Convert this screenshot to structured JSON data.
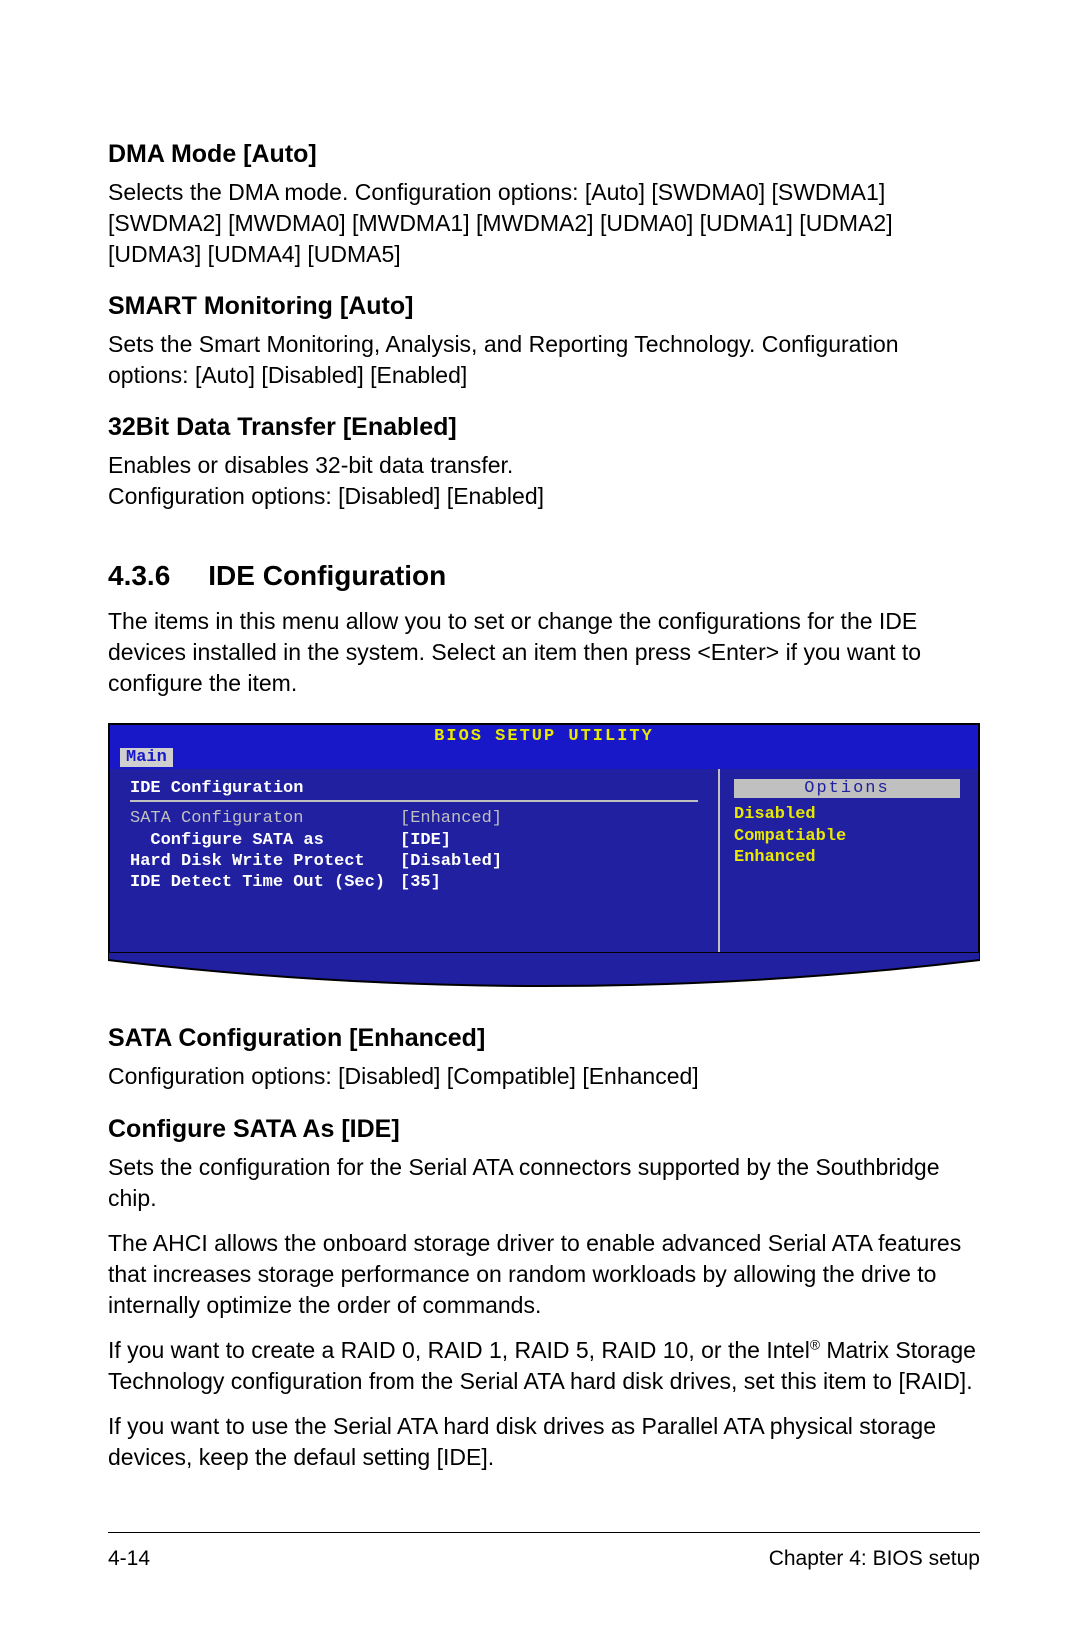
{
  "items": [
    {
      "heading": "DMA Mode [Auto]",
      "body": "Selects the DMA mode. Configuration options: [Auto] [SWDMA0] [SWDMA1] [SWDMA2] [MWDMA0] [MWDMA1] [MWDMA2] [UDMA0] [UDMA1] [UDMA2] [UDMA3] [UDMA4] [UDMA5]"
    },
    {
      "heading": "SMART Monitoring [Auto]",
      "body": "Sets the Smart Monitoring, Analysis, and Reporting Technology. Configuration options: [Auto] [Disabled] [Enabled]"
    },
    {
      "heading": "32Bit Data Transfer [Enabled]",
      "body": "Enables or disables 32-bit data transfer.\nConfiguration options: [Disabled] [Enabled]"
    }
  ],
  "section": {
    "number": "4.3.6",
    "title": "IDE Configuration",
    "intro": "The items in this menu allow you to set or change the configurations for the IDE devices installed in the system. Select an item then press <Enter> if you want to configure the item."
  },
  "bios": {
    "header": "BIOS SETUP UTILITY",
    "tab": "Main",
    "panel_title": "IDE Configuration",
    "rows": [
      {
        "label": "SATA Configuraton",
        "value": "[Enhanced]",
        "highlight": true
      },
      {
        "label": "  Configure SATA as",
        "value": "[IDE]",
        "highlight": false,
        "bold": true
      },
      {
        "label": "",
        "value": "",
        "highlight": false
      },
      {
        "label": "Hard Disk Write Protect",
        "value": "[Disabled]",
        "highlight": false,
        "bold": true
      },
      {
        "label": "IDE Detect Time Out (Sec)",
        "value": "[35]",
        "highlight": false,
        "bold": true
      }
    ],
    "options_header": "Options",
    "options": [
      "Disabled",
      "Compatiable",
      "Enhanced"
    ]
  },
  "post": [
    {
      "heading": "SATA Configuration [Enhanced]",
      "paras": [
        "Configuration options: [Disabled] [Compatible] [Enhanced]"
      ]
    },
    {
      "heading": "Configure SATA As [IDE]",
      "paras": [
        "Sets the configuration for the Serial ATA connectors supported by the Southbridge chip.",
        "The AHCI allows the onboard storage driver to enable advanced Serial ATA features that increases storage performance on random workloads by allowing the drive to internally optimize the order of commands.",
        "If you want to create a RAID 0, RAID 1,  RAID 5,  RAID 10, or the Intel® Matrix Storage Technology configuration from the Serial ATA hard disk drives, set this item to [RAID].",
        "If you want to use the Serial ATA hard disk drives as Parallel ATA physical storage devices, keep the defaul setting [IDE]."
      ]
    }
  ],
  "footer": {
    "left": "4-14",
    "right": "Chapter 4: BIOS setup"
  }
}
